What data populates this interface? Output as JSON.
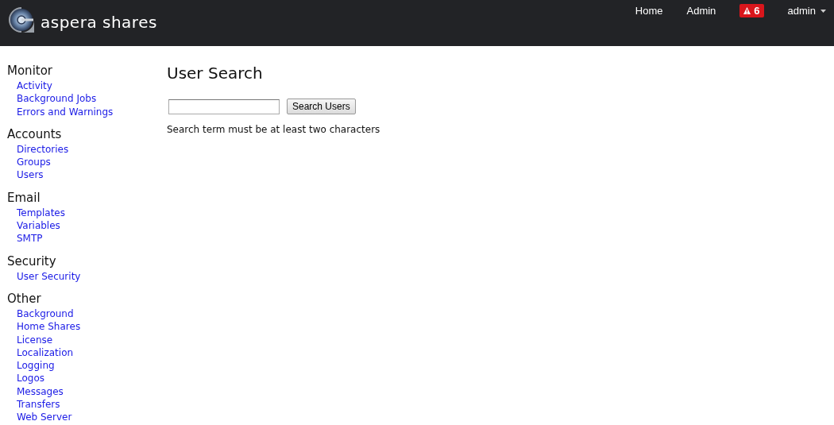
{
  "header": {
    "brand": "aspera shares",
    "nav": [
      {
        "kind": "link",
        "label": "Home"
      },
      {
        "kind": "link",
        "label": "Admin"
      },
      {
        "kind": "alert",
        "label": "6"
      },
      {
        "kind": "dropdown",
        "label": "admin"
      }
    ]
  },
  "sidebar": [
    {
      "title": "Monitor",
      "items": [
        "Activity",
        "Background Jobs",
        "Errors and Warnings"
      ]
    },
    {
      "title": "Accounts",
      "items": [
        "Directories",
        "Groups",
        "Users"
      ]
    },
    {
      "title": "Email",
      "items": [
        "Templates",
        "Variables",
        "SMTP"
      ]
    },
    {
      "title": "Security",
      "items": [
        "User Security"
      ]
    },
    {
      "title": "Other",
      "items": [
        "Background",
        "Home Shares",
        "License",
        "Localization",
        "Logging",
        "Logos",
        "Messages",
        "Transfers",
        "Web Server"
      ]
    }
  ],
  "main": {
    "title": "User Search",
    "search_button": "Search Users",
    "message": "Search term must be at least two characters"
  }
}
